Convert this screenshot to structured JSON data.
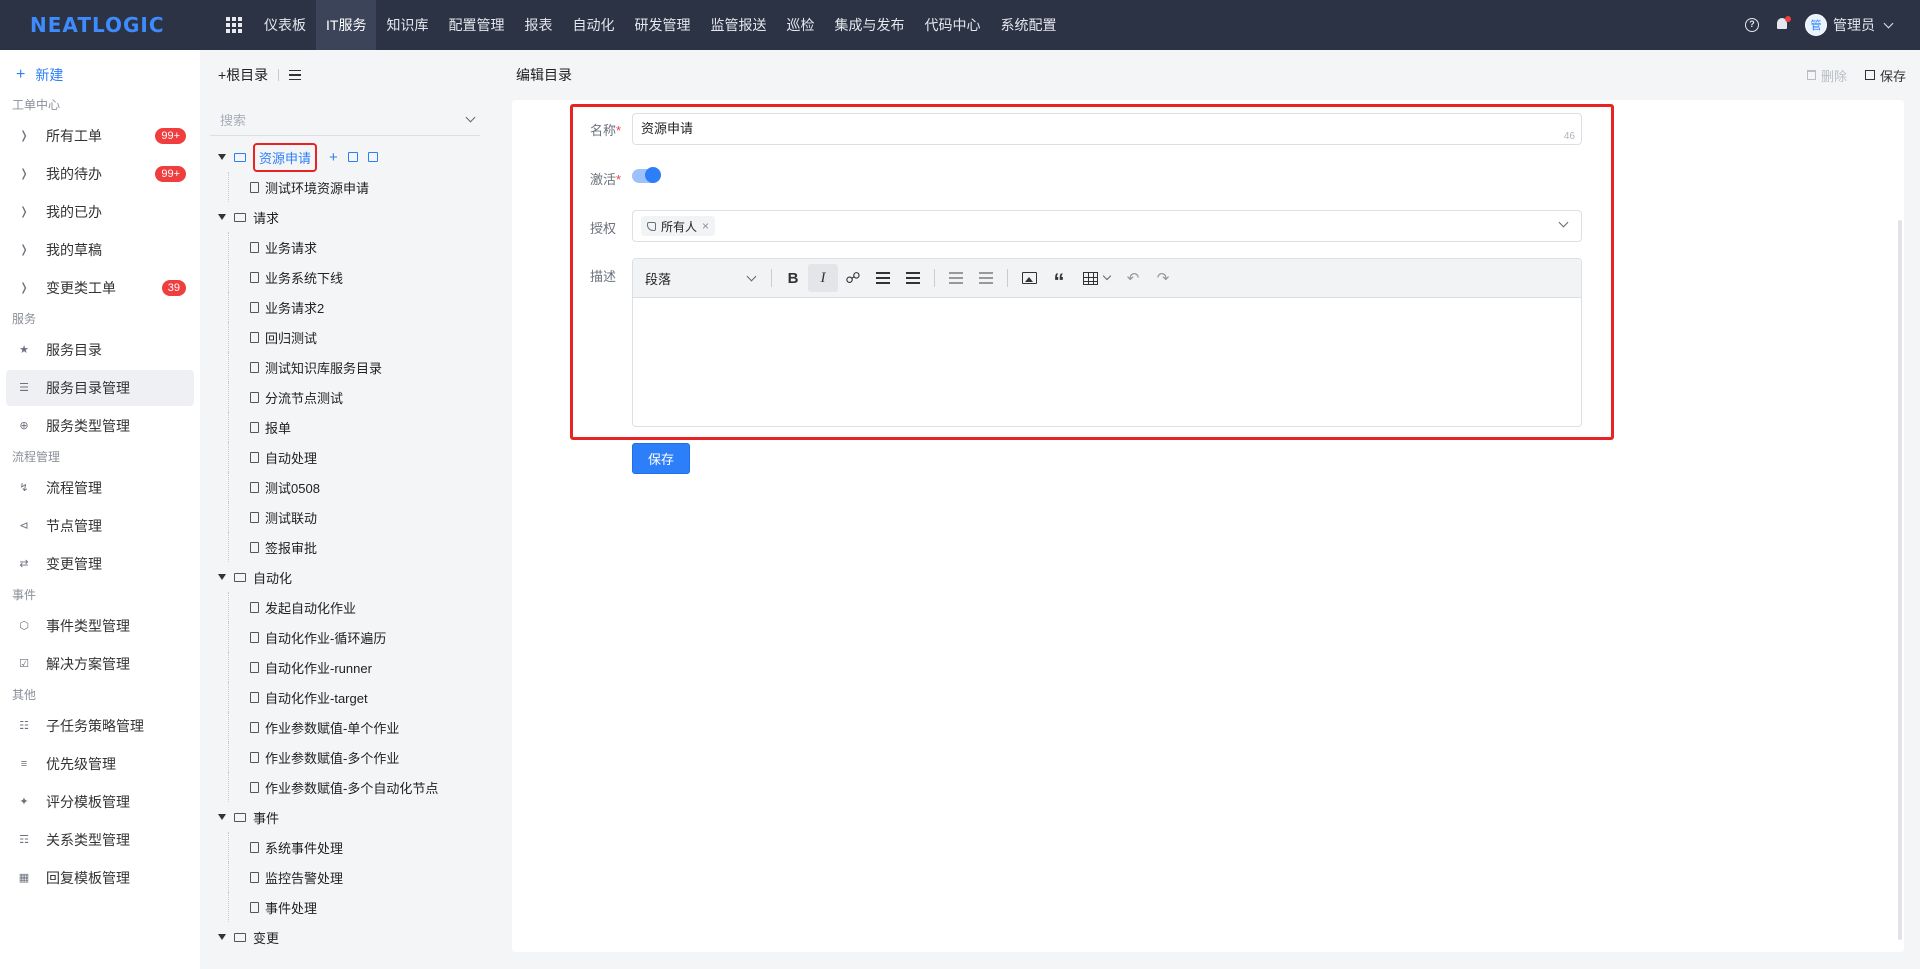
{
  "app": {
    "logo": "NEATLOGIC"
  },
  "topnav": {
    "items": [
      "仪表板",
      "IT服务",
      "知识库",
      "配置管理",
      "报表",
      "自动化",
      "研发管理",
      "监管报送",
      "巡检",
      "集成与发布",
      "代码中心",
      "系统配置"
    ],
    "active_index": 1,
    "user": {
      "avatar_text": "管",
      "name": "管理员"
    }
  },
  "sidebar": {
    "new_label": "新建",
    "groups": [
      {
        "title": "工单中心",
        "items": [
          {
            "label": "所有工单",
            "badge": "99+",
            "icon": "tag-icon"
          },
          {
            "label": "我的待办",
            "badge": "99+",
            "icon": "tag-icon"
          },
          {
            "label": "我的已办",
            "badge": "",
            "icon": "tag-icon"
          },
          {
            "label": "我的草稿",
            "badge": "",
            "icon": "tag-icon"
          },
          {
            "label": "变更类工单",
            "badge": "39",
            "icon": "tag-icon"
          }
        ]
      },
      {
        "title": "服务",
        "items": [
          {
            "label": "服务目录",
            "icon": "star-icon"
          },
          {
            "label": "服务目录管理",
            "icon": "list-icon",
            "active": true
          },
          {
            "label": "服务类型管理",
            "icon": "plus-circle-icon"
          }
        ]
      },
      {
        "title": "流程管理",
        "items": [
          {
            "label": "流程管理",
            "icon": "flow-icon"
          },
          {
            "label": "节点管理",
            "icon": "share-icon"
          },
          {
            "label": "变更管理",
            "icon": "exchange-icon"
          }
        ]
      },
      {
        "title": "事件",
        "items": [
          {
            "label": "事件类型管理",
            "icon": "hexagon-icon"
          },
          {
            "label": "解决方案管理",
            "icon": "calendar-check-icon"
          }
        ]
      },
      {
        "title": "其他",
        "items": [
          {
            "label": "子任务策略管理",
            "icon": "task-icon"
          },
          {
            "label": "优先级管理",
            "icon": "priority-icon"
          },
          {
            "label": "评分模板管理",
            "icon": "star-sparkle-icon"
          },
          {
            "label": "关系类型管理",
            "icon": "relation-icon"
          },
          {
            "label": "回复模板管理",
            "icon": "grid-icon"
          }
        ]
      }
    ]
  },
  "tree": {
    "root_label": "根目录",
    "search_placeholder": "搜索",
    "folders": [
      {
        "label": "资源申请",
        "selected": true,
        "children": [
          "测试环境资源申请"
        ]
      },
      {
        "label": "请求",
        "children": [
          "业务请求",
          "业务系统下线",
          "业务请求2",
          "回归测试",
          "测试知识库服务目录",
          "分流节点测试",
          "报单",
          "自动处理",
          "测试0508",
          "测试联动",
          "签报审批"
        ]
      },
      {
        "label": "自动化",
        "children": [
          "发起自动化作业",
          "自动化作业-循环遍历",
          "自动化作业-runner",
          "自动化作业-target",
          "作业参数赋值-单个作业",
          "作业参数赋值-多个作业",
          "作业参数赋值-多个自动化节点"
        ]
      },
      {
        "label": "事件",
        "children": [
          "系统事件处理",
          "监控告警处理",
          "事件处理"
        ]
      },
      {
        "label": "变更",
        "children": []
      }
    ]
  },
  "main": {
    "title": "编辑目录",
    "delete_label": "删除",
    "save_label": "保存",
    "form": {
      "name_label": "名称",
      "name_value": "资源申请",
      "name_remaining": "46",
      "active_label": "激活",
      "active": true,
      "auth_label": "授权",
      "auth_tag": "所有人",
      "desc_label": "描述",
      "para_select": "段落",
      "submit_label": "保存"
    }
  }
}
